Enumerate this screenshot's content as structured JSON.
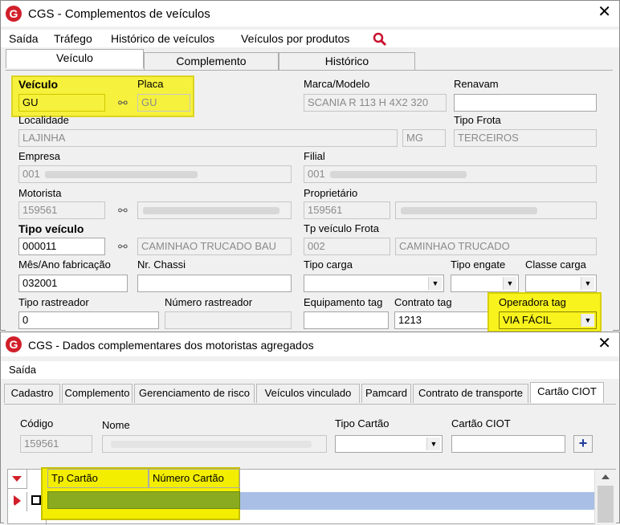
{
  "window1": {
    "logo": "G",
    "title": "CGS - Complementos de veículos",
    "close": "✕",
    "menu": [
      "Saída",
      "Tráfego",
      "Histórico de veículos",
      "Veículos por produtos"
    ],
    "search_icon": "search-icon",
    "tabs": [
      "Veículo",
      "Complemento",
      "Histórico"
    ],
    "fields": {
      "veiculo": {
        "label": "Veículo",
        "value": "GU"
      },
      "placa": {
        "label": "Placa",
        "value": "GU"
      },
      "marca": {
        "label": "Marca/Modelo",
        "value": "SCANIA R 113 H 4X2 320"
      },
      "renavam": {
        "label": "Renavam",
        "value": ""
      },
      "localidade": {
        "label": "Localidade",
        "value": "LAJINHA",
        "uf": "MG"
      },
      "tipo_frota": {
        "label": "Tipo Frota",
        "value": "TERCEIROS"
      },
      "empresa": {
        "label": "Empresa",
        "value": "001"
      },
      "filial": {
        "label": "Filial",
        "value": "001"
      },
      "motorista": {
        "label": "Motorista",
        "value": "159561"
      },
      "proprietario": {
        "label": "Proprietário",
        "value": "159561"
      },
      "tipo_veiculo": {
        "label": "Tipo veículo",
        "value": "000011",
        "desc": "CAMINHAO TRUCADO BAU"
      },
      "tp_veiculo_frota": {
        "label": "Tp veículo Frota",
        "value": "002",
        "desc": "CAMINHAO TRUCADO"
      },
      "mes_ano": {
        "label": "Mês/Ano fabricação",
        "value": "032001"
      },
      "nr_chassi": {
        "label": "Nr. Chassi",
        "value": ""
      },
      "tipo_carga": {
        "label": "Tipo carga",
        "value": ""
      },
      "tipo_engate": {
        "label": "Tipo engate",
        "value": ""
      },
      "classe_carga": {
        "label": "Classe carga",
        "value": ""
      },
      "tipo_rastreador": {
        "label": "Tipo rastreador",
        "value": "0"
      },
      "numero_rastreador": {
        "label": "Número rastreador",
        "value": ""
      },
      "equipamento_tag": {
        "label": "Equipamento tag",
        "value": ""
      },
      "contrato_tag": {
        "label": "Contrato tag",
        "value": "1213"
      },
      "operadora_tag": {
        "label": "Operadora tag",
        "value": "VIA FÁCIL"
      }
    }
  },
  "window2": {
    "logo": "G",
    "title": "CGS - Dados complementares dos motoristas agregados",
    "close": "✕",
    "menu": [
      "Saída"
    ],
    "tabs": [
      "Cadastro",
      "Complemento",
      "Gerenciamento de risco",
      "Veículos vinculado",
      "Pamcard",
      "Contrato de transporte",
      "Cartão CIOT"
    ],
    "fields": {
      "codigo": {
        "label": "Código",
        "value": "159561"
      },
      "nome": {
        "label": "Nome",
        "value": ""
      },
      "tipo_cartao": {
        "label": "Tipo Cartão",
        "value": ""
      },
      "cartao_ciot": {
        "label": "Cartão CIOT",
        "value": ""
      }
    },
    "add_button": "+",
    "grid": {
      "columns": [
        "Tp Cartão",
        "Número Cartão"
      ]
    }
  },
  "colors": {
    "highlight": "#fff93a",
    "selection": "#a9bfe6",
    "brand_red": "#d11f2a"
  }
}
